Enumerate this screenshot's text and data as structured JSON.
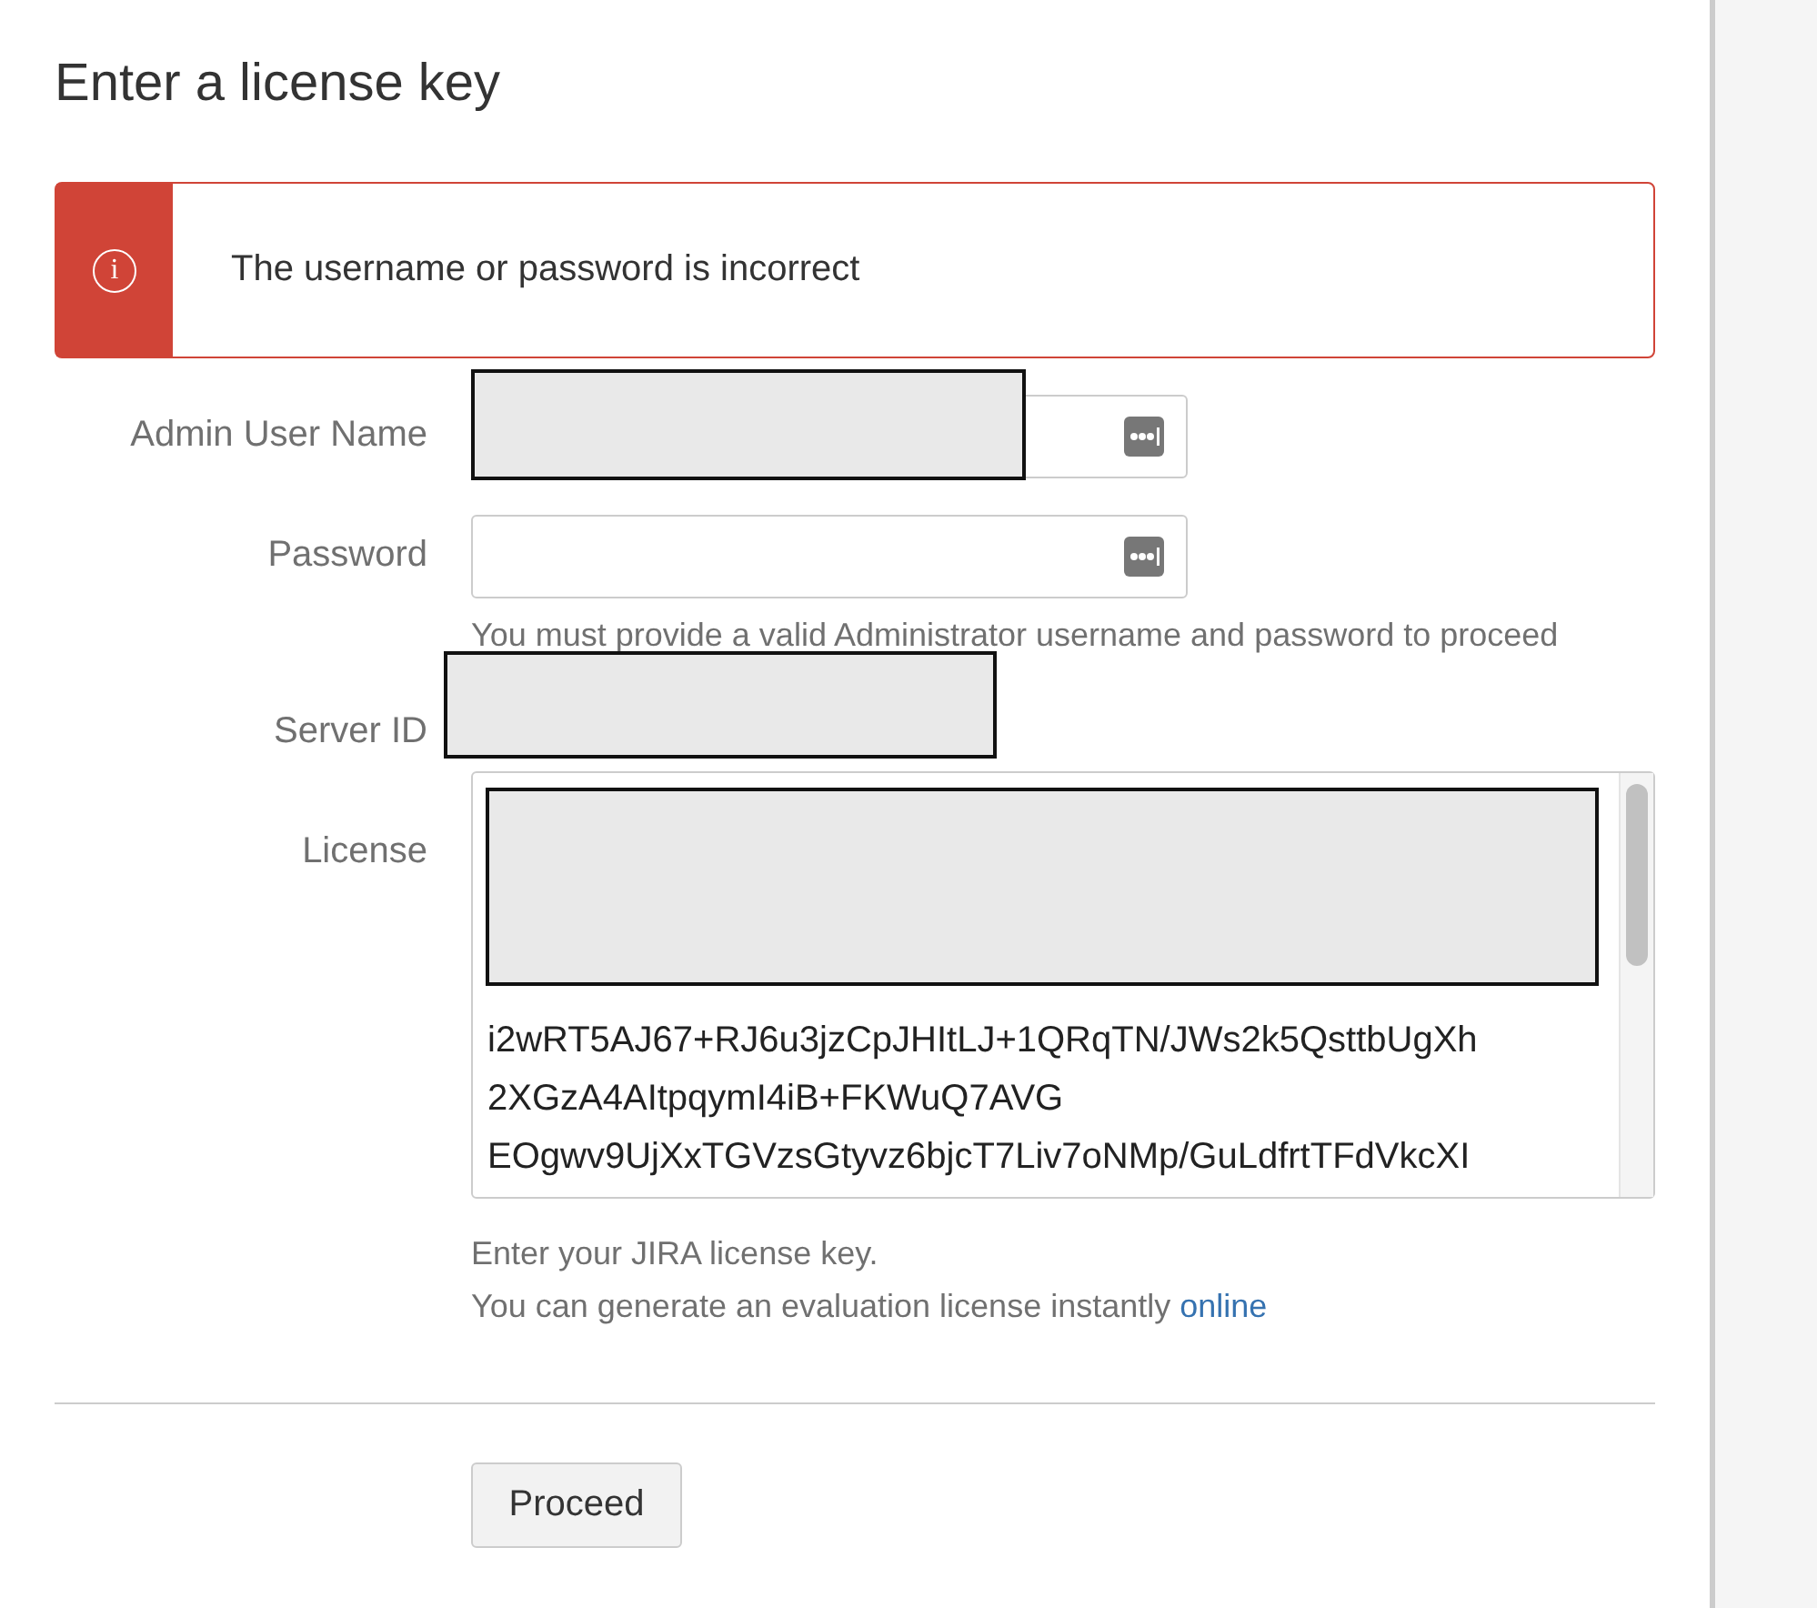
{
  "page_title": "Enter a license key",
  "error_message": {
    "icon": "i",
    "text": "The username or password is incorrect"
  },
  "fields": [
    {
      "label": "Admin User Name",
      "kind": "text",
      "redacted": true
    },
    {
      "label": "Password",
      "kind": "password",
      "redacted": false,
      "help": "You must provide a valid Administrator username and password to proceed"
    },
    {
      "label": "Server ID",
      "kind": "plain",
      "redacted": true
    }
  ],
  "license": {
    "label": "License",
    "lines": [
      "i2wRT5AJ67+RJ6u3jzCpJHItLJ+1QRqTN/JWs2k5QsttbUgXh",
      "2XGzA4AItpqymI4iB+FKWuQ7AVG",
      "EOgwv9UjXxTGVzsGtyvz6bjcT7Liv7oNMp/GuLdfrtTFdVkcXI"
    ],
    "help": "Enter your JIRA license key.",
    "help2": "You can generate an evaluation license instantly",
    "link": "online"
  },
  "button": "Proceed"
}
